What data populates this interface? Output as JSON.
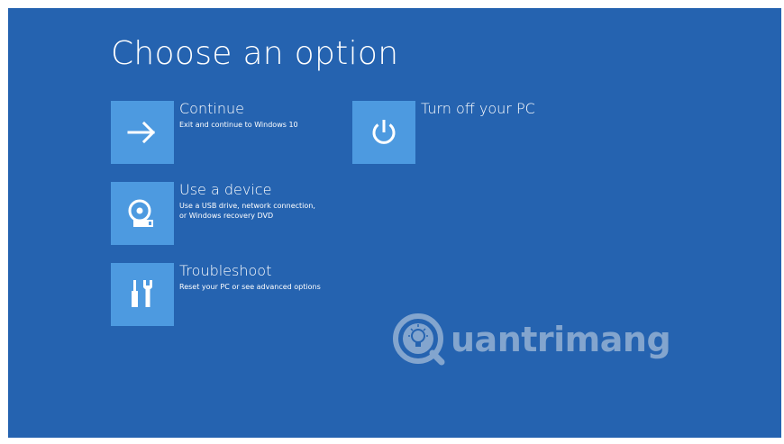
{
  "screen": {
    "title": "Choose an option",
    "background_color": "#2563b0",
    "tile_color": "#4d9ae0"
  },
  "options": [
    {
      "label": "Continue",
      "description": "Exit and continue to Windows 10",
      "icon": "arrow-right-icon"
    },
    {
      "label": "Use a device",
      "description": "Use a USB drive, network connection,\nor Windows recovery DVD",
      "icon": "disc-drive-icon"
    },
    {
      "label": "Troubleshoot",
      "description": "Reset your PC or see advanced options",
      "icon": "tools-icon"
    },
    {
      "label": "Turn off your PC",
      "description": "",
      "icon": "power-icon"
    }
  ],
  "watermark": {
    "text": "uantrimang",
    "icon": "lightbulb-logo-icon"
  }
}
